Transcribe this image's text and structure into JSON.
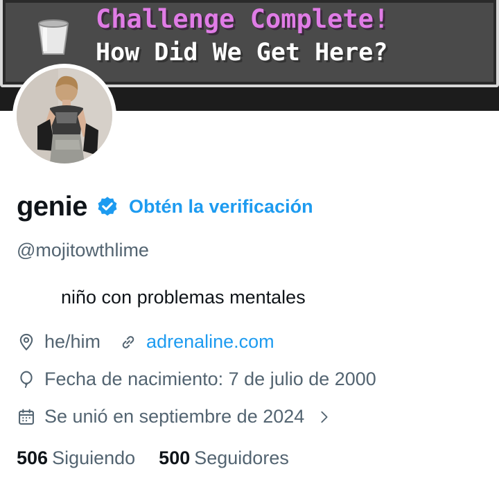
{
  "banner": {
    "title": "Challenge Complete!",
    "subtitle": "How Did We Get Here?",
    "icon": "trophy-cup-icon"
  },
  "profile": {
    "display_name": "genie",
    "verified_icon": "verified-badge-icon",
    "get_verified_label": "Obtén la verificación",
    "handle": "@mojitowthlime",
    "bio": "niño con problemas mentales",
    "location": "he/him",
    "website": "adrenaline.com",
    "birthdate": "Fecha de nacimiento: 7 de julio de 2000",
    "joined": "Se unió en septiembre de 2024"
  },
  "stats": {
    "following_count": "506",
    "following_label": "Siguiendo",
    "followers_count": "500",
    "followers_label": "Seguidores"
  },
  "colors": {
    "accent": "#1d9bf0",
    "secondary_text": "#536471",
    "primary_text": "#0f1419",
    "banner_title": "#e07ce6"
  }
}
